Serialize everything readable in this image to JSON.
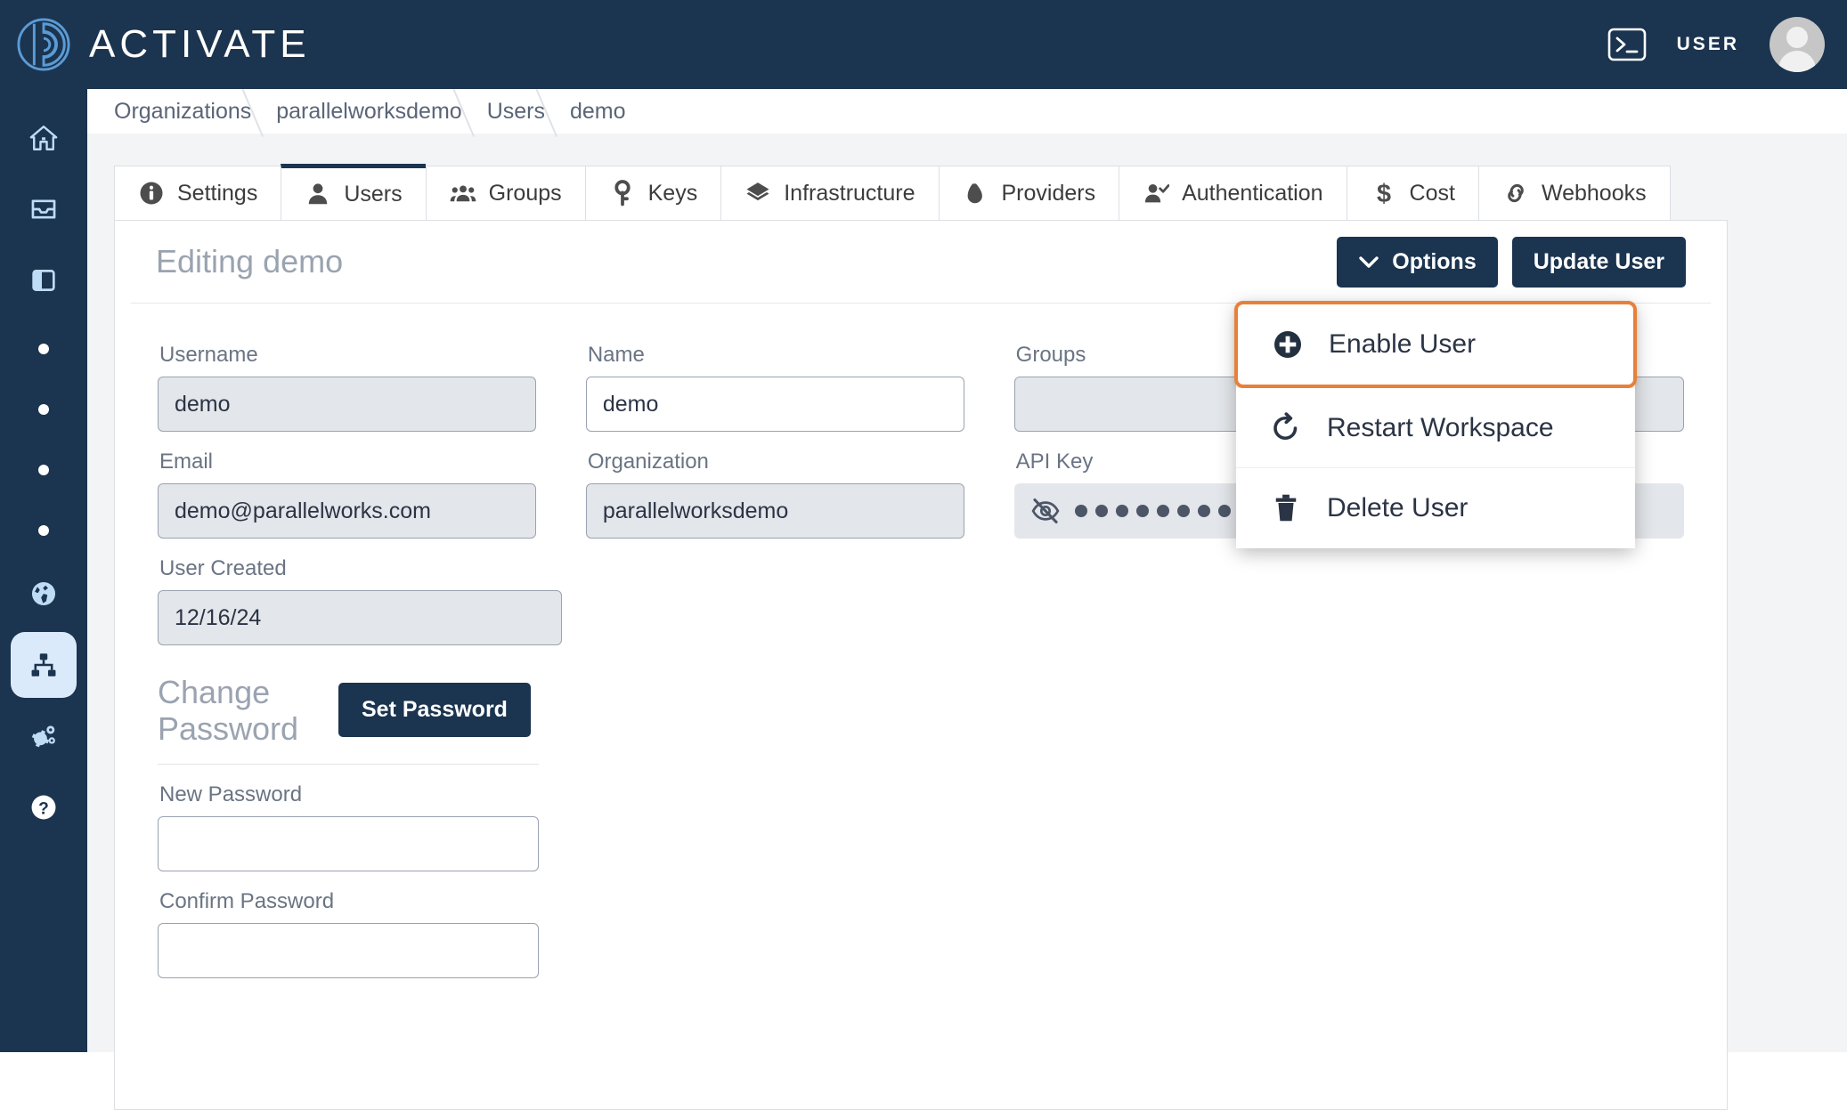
{
  "header": {
    "brand_name": "ACTIVATE",
    "logo_icon": "activate-fingerprint-logo",
    "terminal_icon": "terminal-icon",
    "user_label": "USER",
    "avatar_icon": "user-avatar"
  },
  "sidebar": {
    "items": [
      {
        "icon": "home-icon",
        "active": false
      },
      {
        "icon": "inbox-icon",
        "active": false
      },
      {
        "icon": "panel-icon",
        "active": false
      },
      {
        "icon": "dot-icon",
        "active": false
      },
      {
        "icon": "dot-icon",
        "active": false
      },
      {
        "icon": "dot-icon",
        "active": false
      },
      {
        "icon": "dot-icon",
        "active": false
      },
      {
        "icon": "globe-icon",
        "active": false
      },
      {
        "icon": "sitemap-icon",
        "active": true
      },
      {
        "icon": "gears-icon",
        "active": false
      },
      {
        "icon": "help-icon",
        "active": false
      }
    ]
  },
  "breadcrumb": [
    {
      "label": "Organizations"
    },
    {
      "label": "parallelworksdemo"
    },
    {
      "label": "Users"
    },
    {
      "label": "demo"
    }
  ],
  "tabs": [
    {
      "label": "Settings",
      "icon": "info-icon",
      "active": false
    },
    {
      "label": "Users",
      "icon": "user-icon",
      "active": true
    },
    {
      "label": "Groups",
      "icon": "users-group-icon",
      "active": false
    },
    {
      "label": "Keys",
      "icon": "key-icon",
      "active": false
    },
    {
      "label": "Infrastructure",
      "icon": "layers-icon",
      "active": false
    },
    {
      "label": "Providers",
      "icon": "cloud-icon",
      "active": false
    },
    {
      "label": "Authentication",
      "icon": "user-check-icon",
      "active": false
    },
    {
      "label": "Cost",
      "icon": "dollar-icon",
      "active": false
    },
    {
      "label": "Webhooks",
      "icon": "link-icon",
      "active": false
    }
  ],
  "card": {
    "title": "Editing demo",
    "options_button": "Options",
    "options_chevron_icon": "chevron-down-icon",
    "update_button": "Update User"
  },
  "form": {
    "username": {
      "label": "Username",
      "value": "demo",
      "placeholder": "",
      "disabled": true
    },
    "name": {
      "label": "Name",
      "value": "demo",
      "placeholder": "",
      "disabled": false
    },
    "groups": {
      "label": "Groups",
      "value": "",
      "placeholder": "",
      "disabled": true
    },
    "email": {
      "label": "Email",
      "value": "demo@parallelworks.com",
      "placeholder": "",
      "disabled": true
    },
    "organization": {
      "label": "Organization",
      "value": "parallelworksdemo",
      "placeholder": "",
      "disabled": true
    },
    "api_key": {
      "label": "API Key",
      "masked_value": "••••••••••••••••••••••••••",
      "dot_count": 26,
      "eye_icon": "eye-slash-icon",
      "disabled": true
    },
    "user_created": {
      "label": "User Created",
      "value": "12/16/24",
      "placeholder": "",
      "disabled": true
    }
  },
  "change_password": {
    "title": "Change Password",
    "set_password_button": "Set Password",
    "new_password": {
      "label": "New Password",
      "value": "",
      "placeholder": ""
    },
    "confirm_password": {
      "label": "Confirm Password",
      "value": "",
      "placeholder": ""
    }
  },
  "dropdown": {
    "items": [
      {
        "label": "Enable User",
        "icon": "plus-circle-icon",
        "highlighted": true
      },
      {
        "label": "Restart Workspace",
        "icon": "restart-icon",
        "highlighted": false
      },
      {
        "label": "Delete User",
        "icon": "trash-icon",
        "highlighted": false
      }
    ]
  },
  "colors": {
    "brand_navy": "#1b344f",
    "highlight_orange": "#e8803a",
    "page_background": "#f2f4f6",
    "disabled_field": "#e3e6ea",
    "sidebar_icon": "#bfdcf5"
  }
}
